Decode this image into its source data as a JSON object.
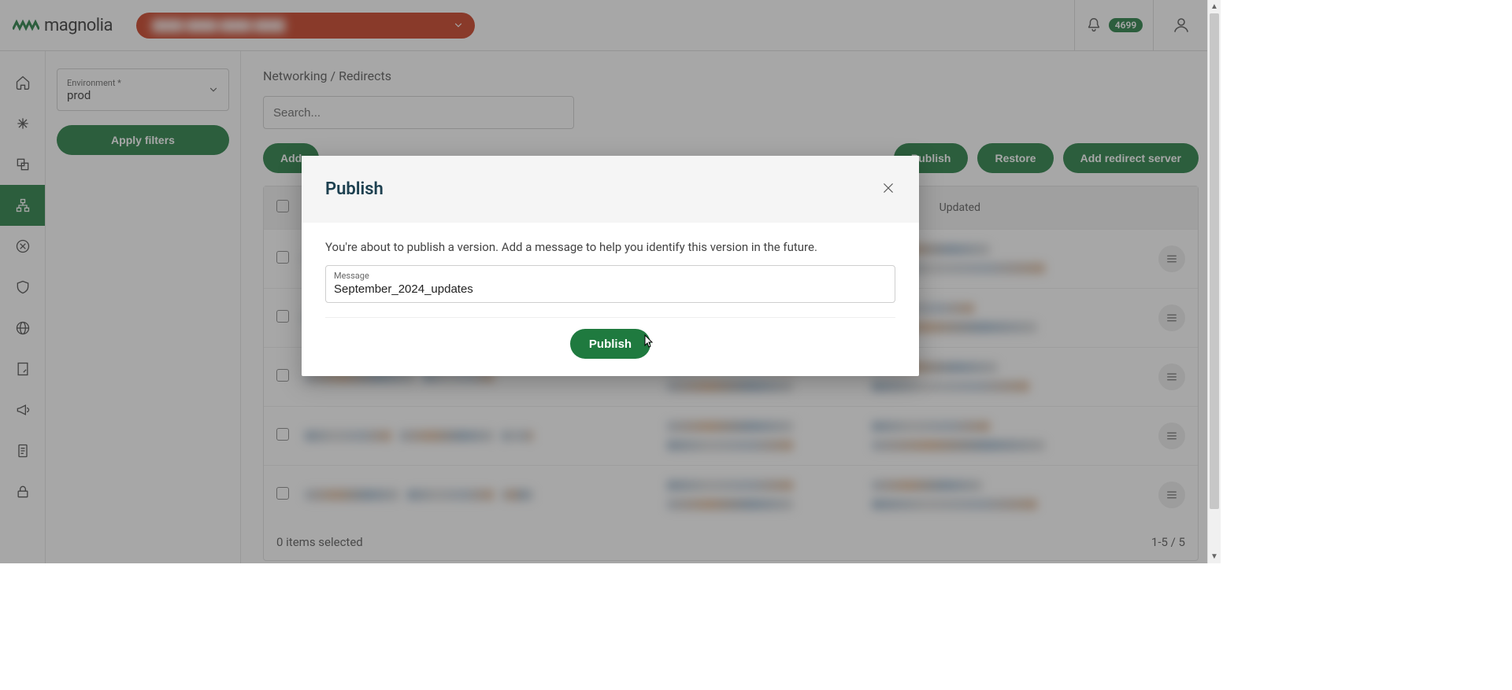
{
  "brand": {
    "name": "magnolia"
  },
  "header": {
    "notification_count": "4699"
  },
  "sidebar": {
    "env_label": "Environment *",
    "env_value": "prod",
    "apply_label": "Apply filters"
  },
  "breadcrumb": {
    "section": "Networking",
    "page": "Redirects"
  },
  "search": {
    "placeholder": "Search..."
  },
  "toolbar": {
    "add_label": "Add",
    "publish_label": "Publish",
    "restore_label": "Restore",
    "add_server_label": "Add redirect server"
  },
  "table": {
    "columns": {
      "updated": "Updated"
    },
    "items_selected": "0 items selected",
    "pagination": "1-5 / 5",
    "rows": [
      {},
      {},
      {},
      {},
      {}
    ]
  },
  "modal": {
    "title": "Publish",
    "description": "You're about to publish a version. Add a message to help you identify this version in the future.",
    "message_label": "Message",
    "message_value": "September_2024_updates",
    "confirm_label": "Publish"
  }
}
